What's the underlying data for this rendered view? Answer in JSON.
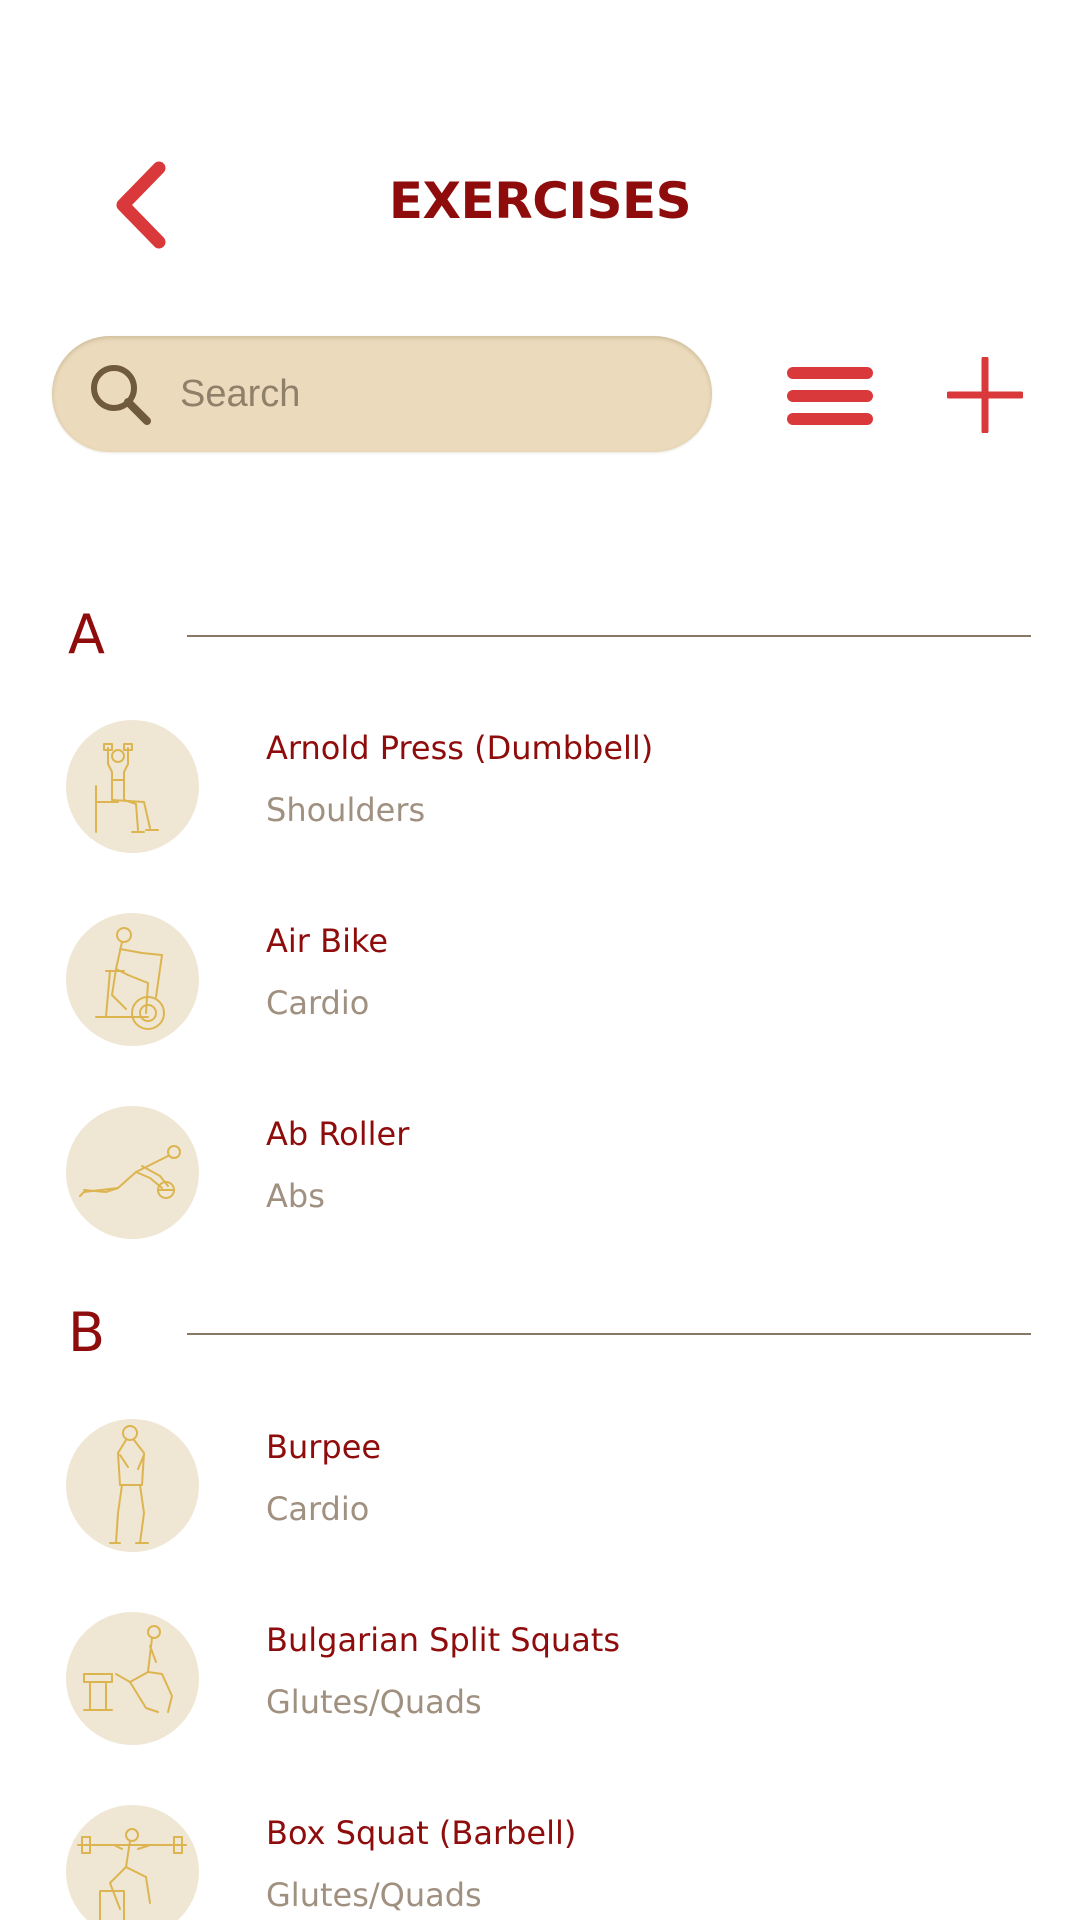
{
  "colors": {
    "accent": "#d9393a",
    "title": "#8f0c0c",
    "category_text": "#a09080",
    "search_bg": "#ebdbbc",
    "thumb_bg": "#efe6d4",
    "thumb_line": "#ddb550",
    "divider": "#8a7866",
    "search_icon": "#6f5a3e"
  },
  "header": {
    "title": "EXERCISES",
    "back_icon": "chevron-left-icon"
  },
  "toolbar": {
    "search_placeholder": "Search",
    "search_value": "",
    "search_icon": "search-icon",
    "menu_icon": "hamburger-menu-icon",
    "add_icon": "plus-icon"
  },
  "sections": [
    {
      "letter": "A",
      "items": [
        {
          "name": "Arnold Press (Dumbbell)",
          "category": "Shoulders",
          "icon": "seated-press-figure"
        },
        {
          "name": "Air Bike",
          "category": "Cardio",
          "icon": "bike-figure"
        },
        {
          "name": "Ab Roller",
          "category": "Abs",
          "icon": "ab-roller-figure"
        }
      ]
    },
    {
      "letter": "B",
      "items": [
        {
          "name": "Burpee",
          "category": "Cardio",
          "icon": "standing-figure"
        },
        {
          "name": "Bulgarian Split Squats",
          "category": "Glutes/Quads",
          "icon": "split-squat-figure"
        },
        {
          "name": "Box Squat (Barbell)",
          "category": "Glutes/Quads",
          "icon": "box-squat-figure"
        }
      ]
    }
  ]
}
